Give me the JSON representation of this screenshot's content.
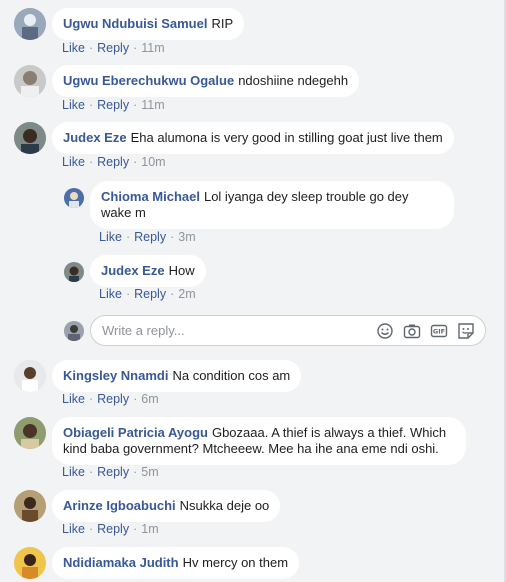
{
  "actions": {
    "like": "Like",
    "reply": "Reply",
    "separator": "·"
  },
  "comments": [
    {
      "author": "Ugwu Ndubuisi Samuel",
      "text": "RIP",
      "time": "11m"
    },
    {
      "author": "Ugwu Eberechukwu Ogalue",
      "text": "ndoshiine ndegehh",
      "time": "11m"
    },
    {
      "author": "Judex Eze",
      "text": "Eha alumona is very good in stilling goat just live them",
      "time": "10m",
      "replies": [
        {
          "author": "Chioma Michael",
          "text_line1": "Lol iyanga dey sleep trouble go dey",
          "text_line2": "wake m",
          "time": "3m"
        },
        {
          "author": "Judex Eze",
          "text": "How",
          "time": "2m"
        }
      ]
    },
    {
      "author": "Kingsley Nnamdi",
      "text": "Na condition cos am",
      "time": "6m"
    },
    {
      "author": "Obiageli Patricia Ayogu",
      "text_line1": "Gbozaaa. A thief is always a thief. Which",
      "text_line2": "kind baba government? Mtcheeew. Mee ha ihe ana eme ndi oshi.",
      "time": "5m"
    },
    {
      "author": "Arinze Igboabuchi",
      "text": "Nsukka deje oo",
      "time": "1m"
    },
    {
      "author": "Ndidiamaka Judith",
      "text": "Hv mercy on them",
      "time": ""
    }
  ],
  "reply_box": {
    "placeholder": "Write a reply..."
  },
  "icons": [
    "emoji-icon",
    "camera-icon",
    "gif-icon",
    "sticker-icon"
  ]
}
